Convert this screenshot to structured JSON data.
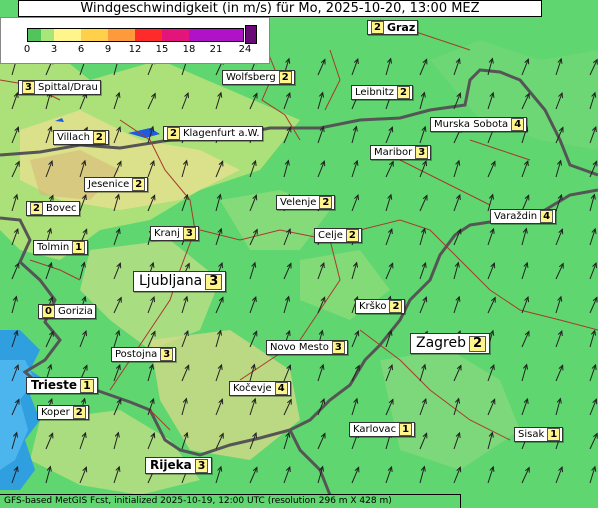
{
  "title": "Windgeschwindigkeit (in m/s) für Mo, 2025-10-20, 13:00 MEZ",
  "legend": {
    "ticks": [
      "0",
      "3",
      "6",
      "9",
      "12",
      "15",
      "18",
      "21",
      "24"
    ],
    "colors": [
      "#52c45c",
      "#a6e67a",
      "#fff58a",
      "#ffd04a",
      "#ff9a3c",
      "#ff2b2b",
      "#e4157a",
      "#b012c8",
      "#6a0a78"
    ]
  },
  "stations": [
    {
      "name": "Graz",
      "value": "2",
      "value_first": true
    },
    {
      "name": "Wolfsberg",
      "value": "2"
    },
    {
      "name": "Spittal/Drau",
      "value": "3",
      "value_first": true
    },
    {
      "name": "Leibnitz",
      "value": "2"
    },
    {
      "name": "Villach",
      "value": "2"
    },
    {
      "name": "Klagenfurt a.W.",
      "value": "2",
      "value_first": true
    },
    {
      "name": "Murska Sobota",
      "value": "4"
    },
    {
      "name": "Maribor",
      "value": "3"
    },
    {
      "name": "Jesenice",
      "value": "2"
    },
    {
      "name": "Bovec",
      "value": "2",
      "value_first": true
    },
    {
      "name": "Velenje",
      "value": "2"
    },
    {
      "name": "Varaždin",
      "value": "4"
    },
    {
      "name": "Kranj",
      "value": "3"
    },
    {
      "name": "Celje",
      "value": "2"
    },
    {
      "name": "Tolmin",
      "value": "1"
    },
    {
      "name": "Ljubljana",
      "value": "3"
    },
    {
      "name": "Gorizia",
      "value": "0",
      "value_first": true
    },
    {
      "name": "Krško",
      "value": "2"
    },
    {
      "name": "Zagreb",
      "value": "2"
    },
    {
      "name": "Novo Mesto",
      "value": "3"
    },
    {
      "name": "Postojna",
      "value": "3"
    },
    {
      "name": "Trieste",
      "value": "1"
    },
    {
      "name": "Kočevje",
      "value": "4"
    },
    {
      "name": "Koper",
      "value": "2"
    },
    {
      "name": "Karlovac",
      "value": "1"
    },
    {
      "name": "Sisak",
      "value": "1"
    },
    {
      "name": "Rijeka",
      "value": "3"
    }
  ],
  "footer": "GFS-based MetGIS Fcst, initialized 2025-10-19, 12:00 UTC  (resolution 296 m X 428 m)",
  "wind_direction": "south-west to north-east"
}
